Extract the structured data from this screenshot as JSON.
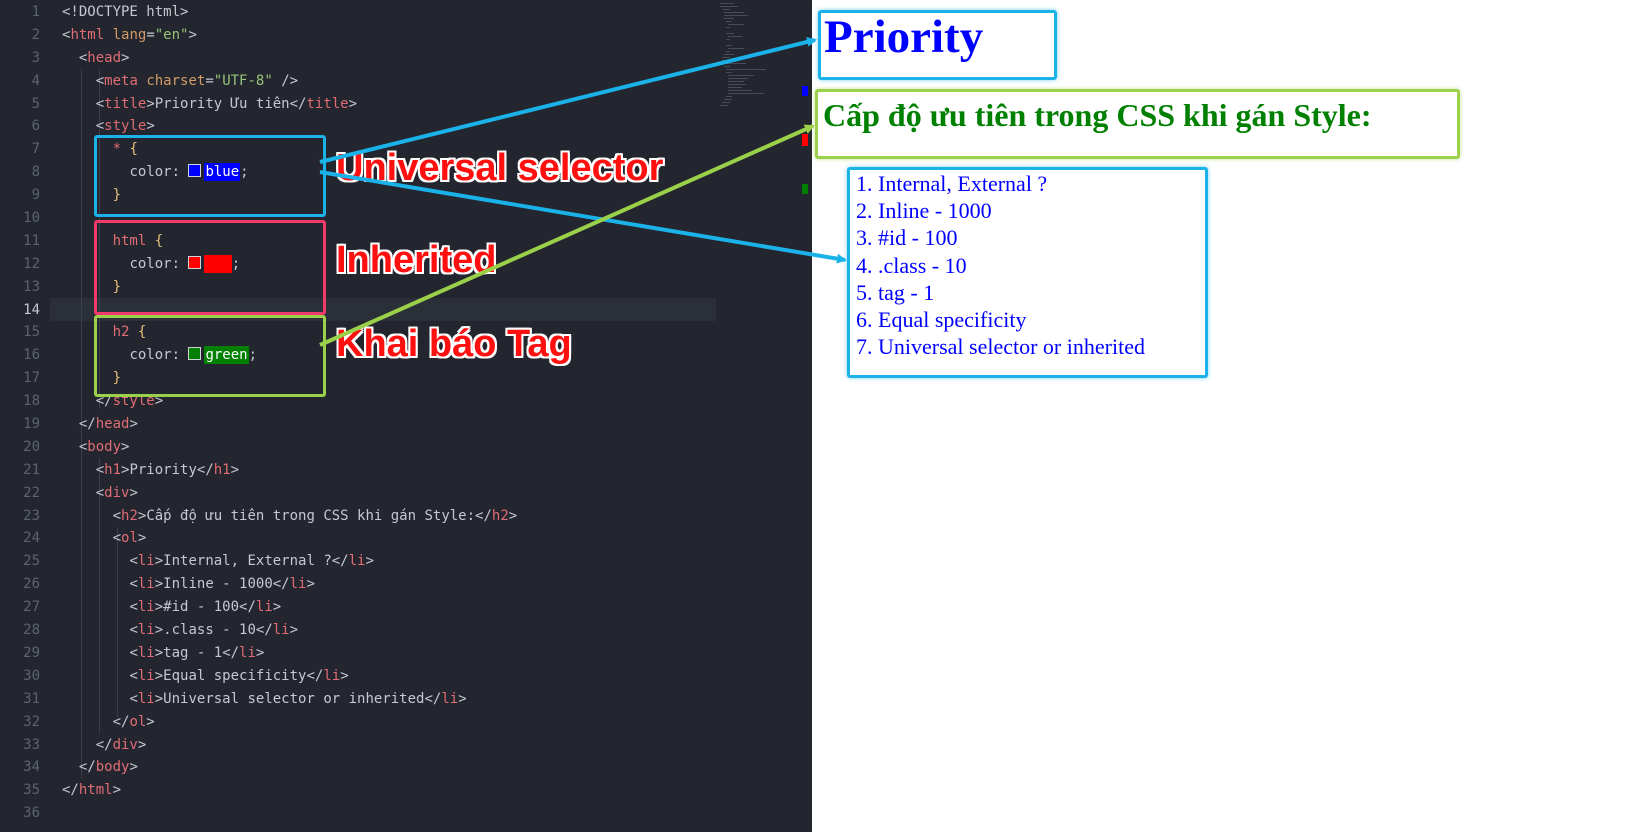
{
  "editor": {
    "active_line": 14,
    "lines": [
      "1",
      "2",
      "3",
      "4",
      "5",
      "6",
      "7",
      "8",
      "9",
      "10",
      "11",
      "12",
      "13",
      "14",
      "15",
      "16",
      "17",
      "18",
      "19",
      "20",
      "21",
      "22",
      "23",
      "24",
      "25",
      "26",
      "27",
      "28",
      "29",
      "30",
      "31",
      "32",
      "33",
      "34",
      "35",
      "36"
    ],
    "code": {
      "l1": "<!DOCTYPE html>",
      "l2_tag": "html",
      "l2_attr": "lang",
      "l2_val": "\"en\"",
      "l3_tag": "head",
      "l4_tag": "meta",
      "l4_attr": "charset",
      "l4_val": "\"UTF-8\"",
      "l5_open": "title",
      "l5_text": "Priority Ưu tiên",
      "l5_close": "title",
      "l6_tag": "style",
      "l7_sel": "*",
      "l8_prop": "color:",
      "l8_val": "blue",
      "l11_sel": "html",
      "l12_prop": "color:",
      "l12_val": "red",
      "l15_sel": "h2",
      "l16_prop": "color:",
      "l16_val": "green",
      "l18_tag": "style",
      "l19_tag": "head",
      "l20_tag": "body",
      "l21_open": "h1",
      "l21_text": "Priority",
      "l21_close": "h1",
      "l22_tag": "div",
      "l23_open": "h2",
      "l23_text": "Cấp độ ưu tiên trong CSS khi gán Style:",
      "l23_close": "h2",
      "l24_tag": "ol",
      "li_tag": "li",
      "l25_text": "Internal, External ?",
      "l26_text": "Inline - 1000",
      "l27_text": "#id - 100",
      "l28_text": ".class - 10",
      "l29_text": "tag - 1",
      "l30_text": "Equal specificity",
      "l31_text": "Universal selector or inherited",
      "l32_tag": "ol",
      "l33_tag": "div",
      "l34_tag": "body",
      "l35_tag": "html"
    }
  },
  "annotations": {
    "universal": "Universal selector",
    "inherited": "Inherited",
    "tag": "Khai báo Tag"
  },
  "preview": {
    "h1": "Priority",
    "h2": "Cấp độ ưu tiên trong CSS khi gán Style:",
    "items": [
      "1. Internal, External ?",
      "2. Inline - 1000",
      "3. #id - 100",
      "4. .class - 10",
      "5. tag - 1",
      "6. Equal specificity",
      "7. Universal selector or inherited"
    ]
  },
  "colors": {
    "editor_bg": "#23262e",
    "box_blue": "#1ab2e8",
    "box_red": "#f03a6a",
    "box_green": "#9bd14a",
    "text_blue": "#0000ff",
    "text_green": "#008000",
    "callout_red": "#ff1010"
  }
}
